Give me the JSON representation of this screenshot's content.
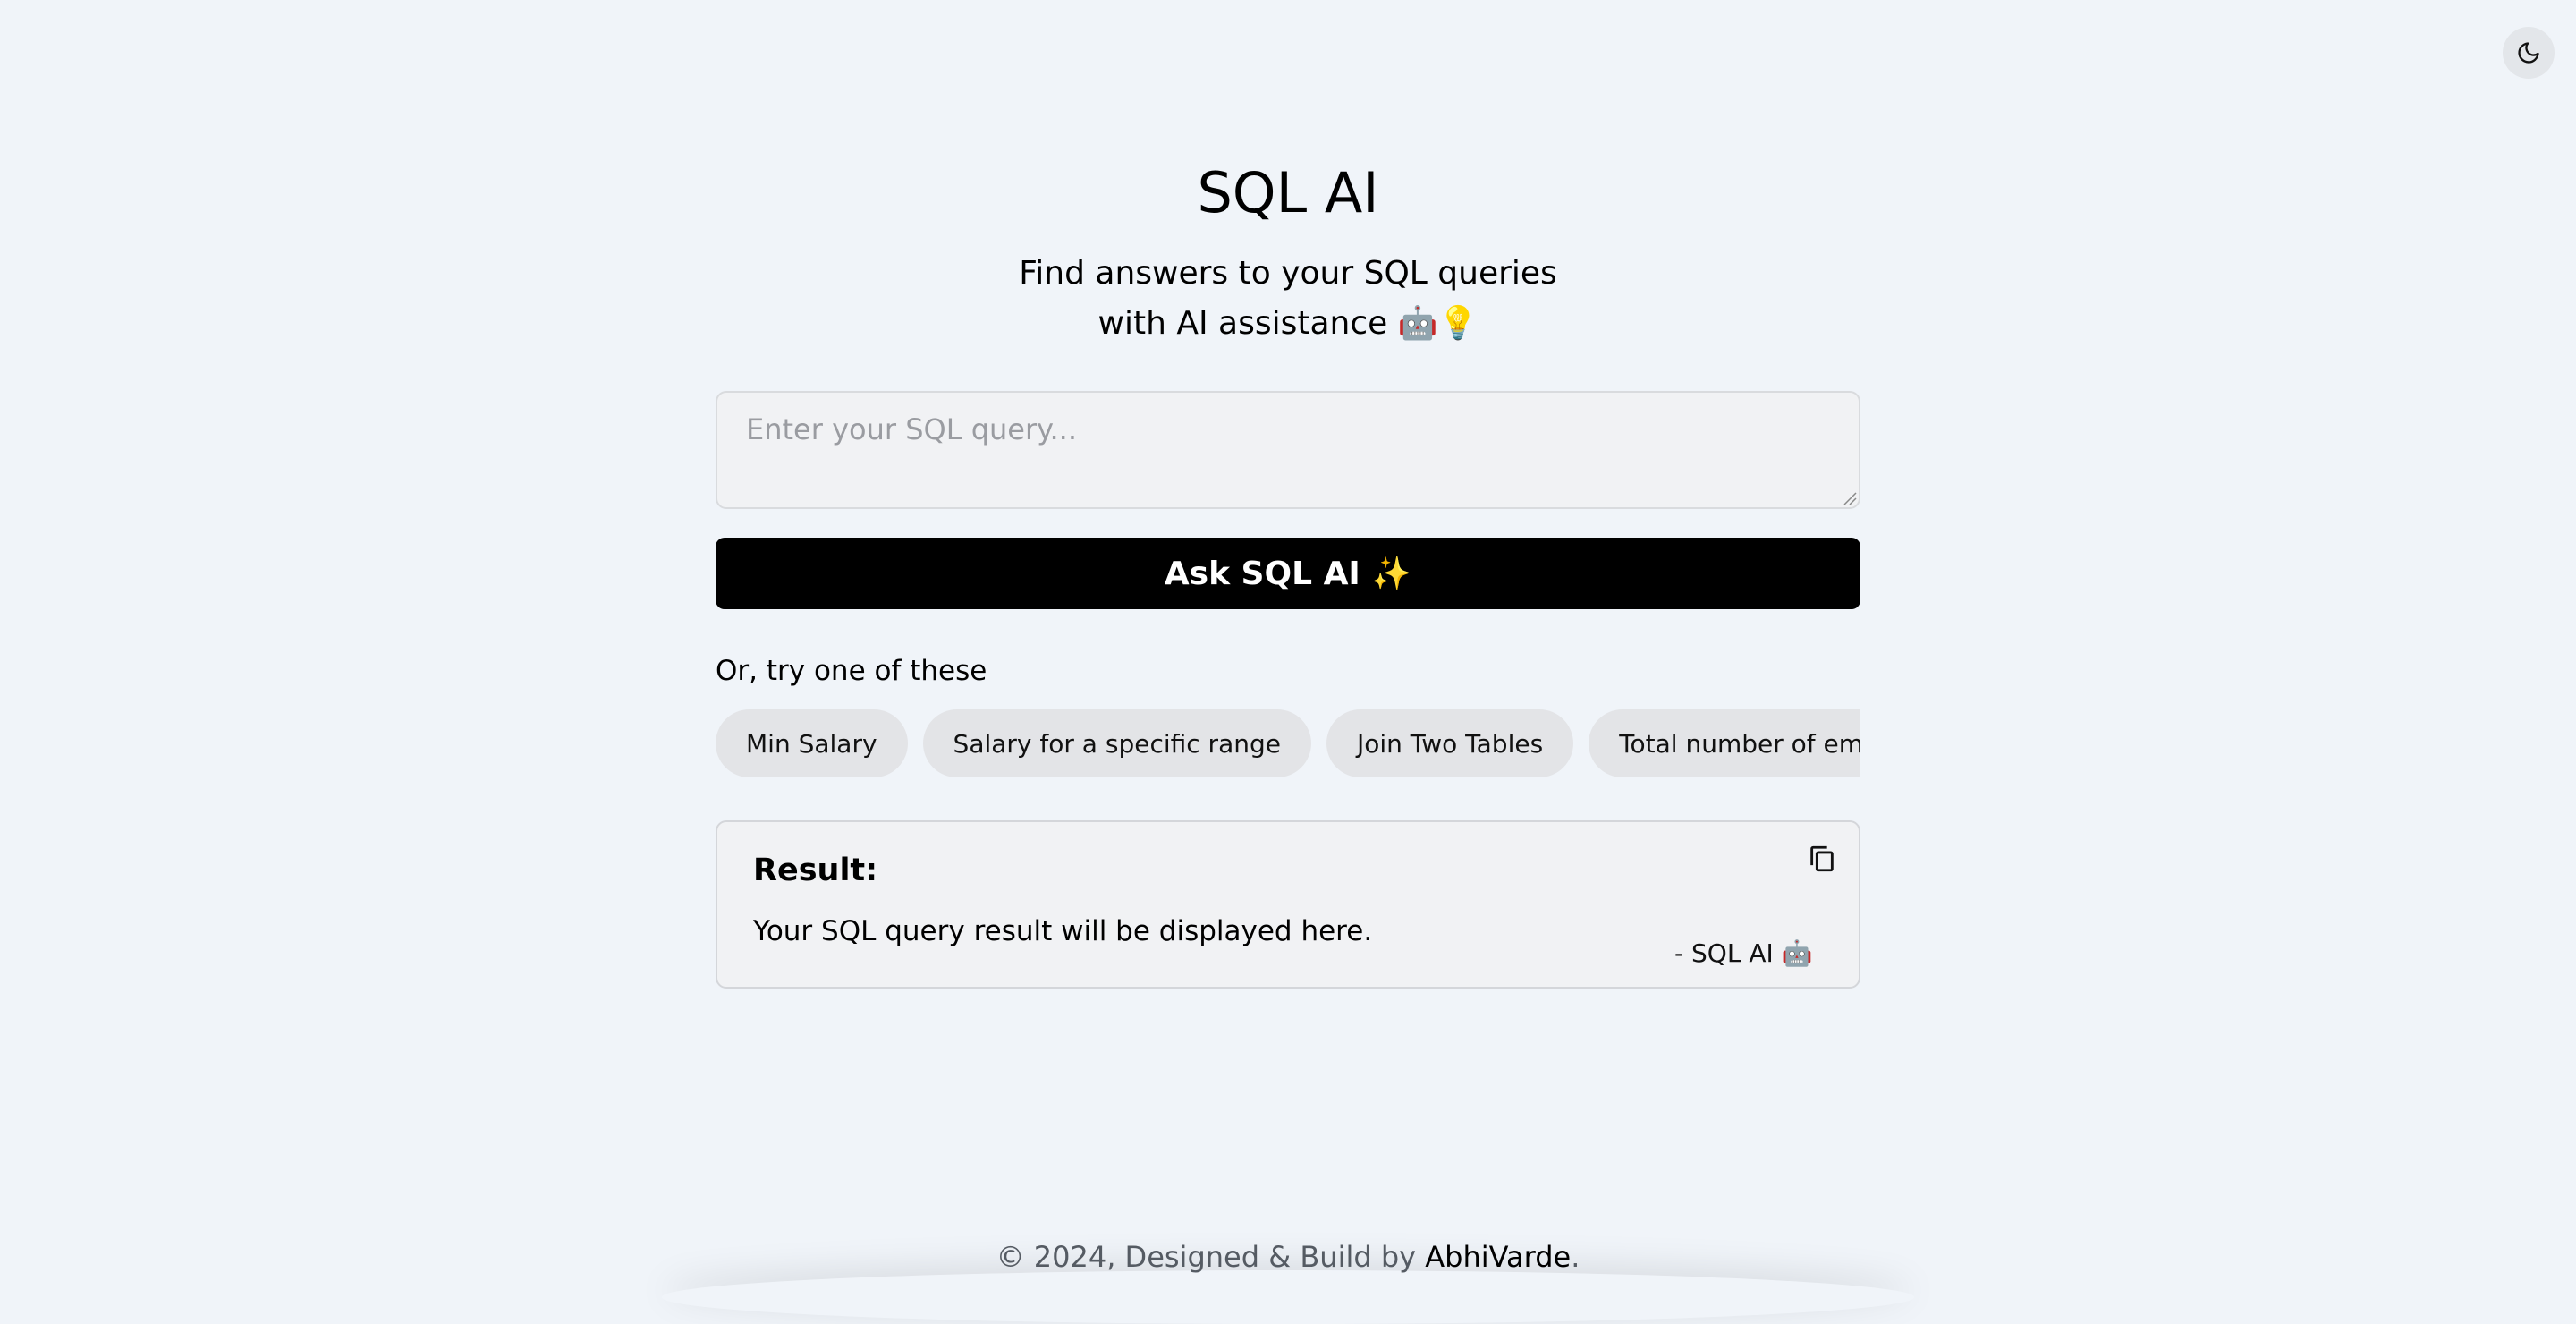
{
  "header": {
    "theme_toggle_icon": "moon-icon"
  },
  "hero": {
    "title": "SQL AI",
    "subtitle_line1": "Find answers to your SQL queries",
    "subtitle_line2": "with AI assistance",
    "subtitle_emoji1": "🤖",
    "subtitle_emoji2": "💡"
  },
  "query": {
    "placeholder": "Enter your SQL query...",
    "value": ""
  },
  "ask_button": {
    "label": "Ask SQL AI ✨"
  },
  "suggestions": {
    "label": "Or, try one of these",
    "items": [
      "Min Salary",
      "Salary for a specific range",
      "Join Two Tables",
      "Total number of employees"
    ]
  },
  "result": {
    "title": "Result:",
    "text": "Your SQL query result will be displayed here.",
    "signature": "- SQL AI 🤖",
    "copy_icon": "copy-icon"
  },
  "footer": {
    "prefix": "© 2024, Designed & Build by ",
    "author": "AbhiVarde",
    "suffix": "."
  },
  "colors": {
    "background": "#f0f4f9",
    "button": "#000000",
    "chip": "#e3e4e7",
    "card": "#f1f2f4"
  }
}
